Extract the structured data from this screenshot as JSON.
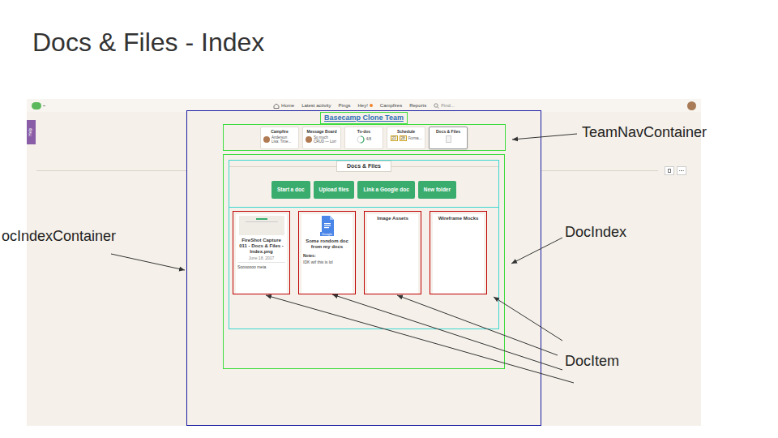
{
  "slide_title": "Docs & Files - Index",
  "app": {
    "top_nav": [
      {
        "label": "Home",
        "kind": "home",
        "badge": false
      },
      {
        "label": "Latest activity",
        "kind": "link",
        "badge": false
      },
      {
        "label": "Pings",
        "kind": "link",
        "badge": false
      },
      {
        "label": "Hey!",
        "kind": "link",
        "badge": true
      },
      {
        "label": "Campfires",
        "kind": "link",
        "badge": false
      },
      {
        "label": "Reports",
        "kind": "link",
        "badge": false
      }
    ],
    "search": {
      "placeholder": "Find..."
    },
    "help_tab": "Help",
    "team_name": "Basecamp Clone Team",
    "tools": [
      {
        "name": "Campfire",
        "kind": "avatar",
        "preview": "Anderson Lisa: Time...",
        "selected": false
      },
      {
        "name": "Message Board",
        "kind": "avatar",
        "preview": "So much CRUD — Lorr",
        "selected": false
      },
      {
        "name": "To-dos",
        "kind": "progress",
        "preview": "4/8",
        "level": 0.5,
        "selected": false
      },
      {
        "name": "Schedule",
        "kind": "calendar",
        "dates": [
          "23",
          "28"
        ],
        "preview": "Forma...",
        "selected": false
      },
      {
        "name": "Docs & Files",
        "kind": "file",
        "selected": true
      }
    ],
    "section_title": "Docs & Files",
    "buttons": [
      "Start a doc",
      "Upload files",
      "Link a Google doc",
      "New folder"
    ],
    "docs": [
      {
        "kind": "image",
        "title": "FireShot Capture 011 - Docs & Files - Index.png",
        "date": "June 18, 2017",
        "note": "Sooooooo meta"
      },
      {
        "kind": "google",
        "badge": "Google",
        "title": "Some rondom doc from my docs",
        "notes_label": "Notes:",
        "note": "IDK wtf this is lol"
      },
      {
        "kind": "folder",
        "title": "Image Assets"
      },
      {
        "kind": "folder",
        "title": "Wireframe Mocks"
      }
    ]
  },
  "annotations": [
    {
      "label": "TeamNavContainer",
      "target": "team-nav"
    },
    {
      "label": "DocIndex",
      "target": "doc-index"
    },
    {
      "label": "DocItem",
      "target": "doc-item"
    },
    {
      "label": "ocIndexContainer",
      "target": "doc-index-container"
    }
  ]
}
